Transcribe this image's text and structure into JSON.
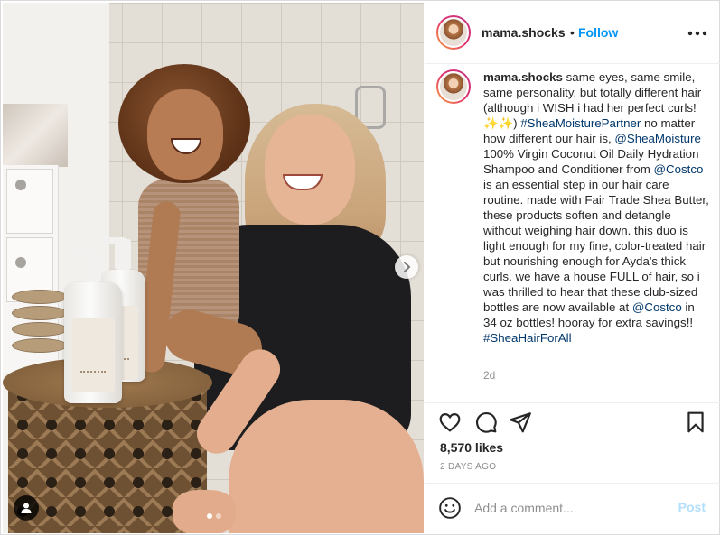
{
  "header": {
    "username": "mama.shocks",
    "bullet": "•",
    "follow_label": "Follow",
    "more_icon": "more-horizontal-icon"
  },
  "caption": {
    "username": "mama.shocks",
    "text_1": " same eyes, same smile, same personality, but totally different hair (although i WISH i had her perfect curls! ✨✨) ",
    "tag_1": "#SheaMoisturePartner",
    "text_2": " no matter how different our hair is, ",
    "tag_2": "@SheaMoisture",
    "text_3": " 100% Virgin Coconut Oil Daily Hydration Shampoo and Conditioner from ",
    "tag_3": "@Costco",
    "text_4": " is an essential step in our hair care routine. made with Fair Trade Shea Butter, these products soften and detangle without weighing hair down. this duo is light enough for my fine, color-treated hair but nourishing enough for Ayda's thick curls. we have a house FULL of hair, so i was thrilled to hear that these club-sized bottles are now available at ",
    "tag_4": "@Costco",
    "text_5": " in 34 oz bottles! hooray for extra savings!! ",
    "tag_5": "#SheaHairForAll",
    "time_ago": "2d"
  },
  "media": {
    "bottle_brand": "SheaMoisture",
    "bottle_product_1": "DAILY HYDRATION SHAMPOO",
    "bottle_product_2": "DAILY HYDRATION CONDITIONER",
    "carousel_count": 2,
    "carousel_active": 1,
    "next_icon": "chevron-right-icon",
    "tagged_icon": "user-tag-icon"
  },
  "actions": {
    "like_icon": "heart-icon",
    "comment_icon": "comment-icon",
    "share_icon": "paper-plane-icon",
    "save_icon": "bookmark-icon"
  },
  "likes": "8,570 likes",
  "date": "2 DAYS AGO",
  "add_comment": {
    "emoji_icon": "smiley-icon",
    "placeholder": "Add a comment...",
    "post_label": "Post"
  },
  "colors": {
    "link_blue": "#0095f6",
    "tag_blue": "#00376b",
    "post_disabled": "#b2dffc",
    "muted": "#8e8e8e"
  }
}
